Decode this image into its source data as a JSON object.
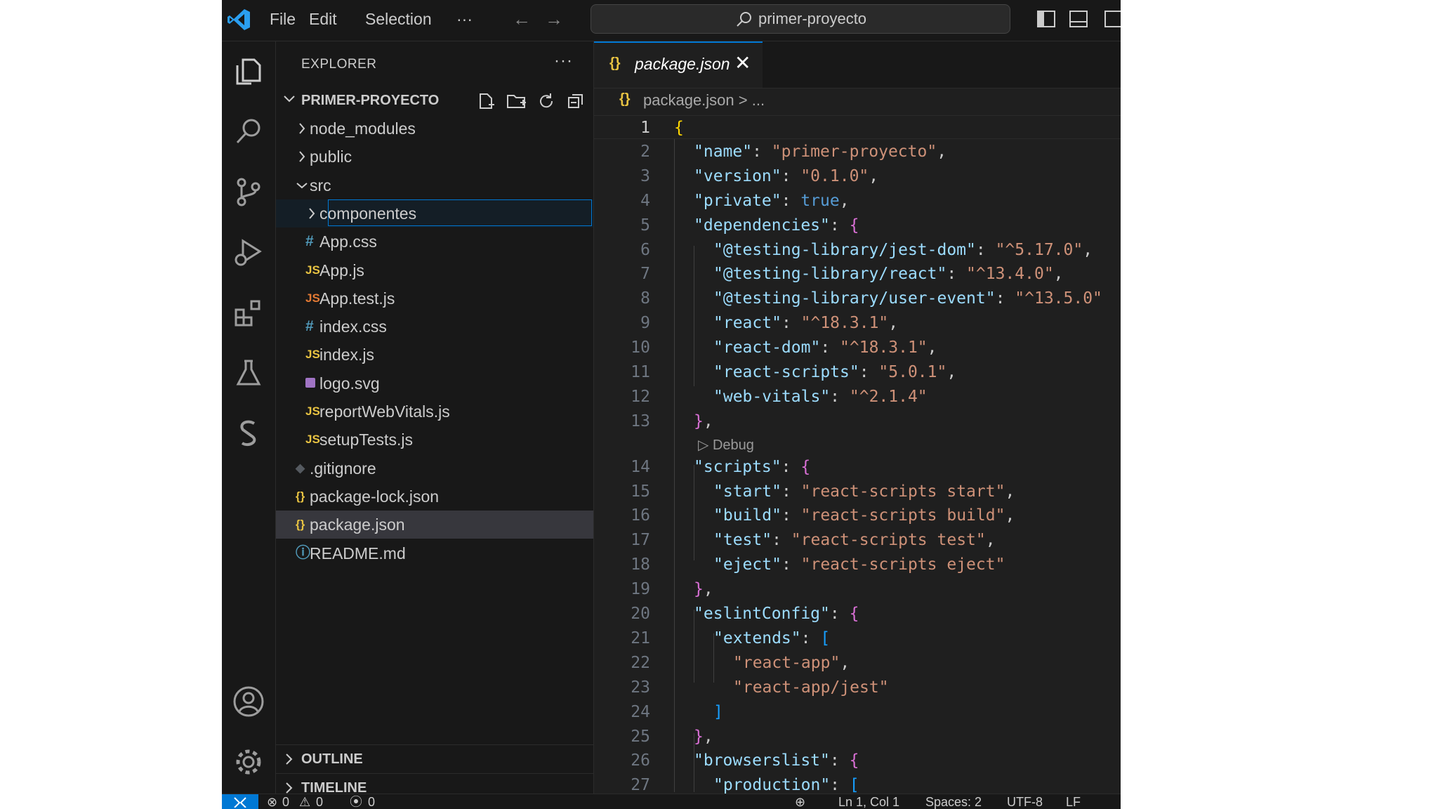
{
  "titlebar": {
    "menu": [
      "File",
      "Edit",
      "Selection",
      "···"
    ],
    "search_text": "primer-proyecto"
  },
  "explorer": {
    "title": "EXPLORER",
    "more": "···",
    "project": "PRIMER-PROYECTO",
    "tree": [
      {
        "name": "node_modules",
        "type": "folder",
        "collapsed": true,
        "depth": 0
      },
      {
        "name": "public",
        "type": "folder",
        "collapsed": true,
        "depth": 0
      },
      {
        "name": "src",
        "type": "folder",
        "collapsed": false,
        "depth": 0
      },
      {
        "name": "componentes",
        "type": "folder",
        "collapsed": true,
        "depth": 1,
        "focused": true
      },
      {
        "name": "App.css",
        "type": "css",
        "icon": "#",
        "depth": 1
      },
      {
        "name": "App.js",
        "type": "js",
        "icon": "JS",
        "depth": 1
      },
      {
        "name": "App.test.js",
        "type": "test",
        "icon": "JS",
        "depth": 1
      },
      {
        "name": "index.css",
        "type": "css",
        "icon": "#",
        "depth": 1
      },
      {
        "name": "index.js",
        "type": "js",
        "icon": "JS",
        "depth": 1
      },
      {
        "name": "logo.svg",
        "type": "svg",
        "icon": "",
        "depth": 1
      },
      {
        "name": "reportWebVitals.js",
        "type": "js",
        "icon": "JS",
        "depth": 1
      },
      {
        "name": "setupTests.js",
        "type": "js",
        "icon": "JS",
        "depth": 1
      },
      {
        "name": ".gitignore",
        "type": "git",
        "icon": "◆",
        "depth": 0
      },
      {
        "name": "package-lock.json",
        "type": "json",
        "icon": "{}",
        "depth": 0
      },
      {
        "name": "package.json",
        "type": "json",
        "icon": "{}",
        "depth": 0,
        "selected": true
      },
      {
        "name": "README.md",
        "type": "info",
        "icon": "ⓘ",
        "depth": 0
      }
    ],
    "sections": [
      "OUTLINE",
      "TIMELINE"
    ]
  },
  "editor": {
    "tab": {
      "icon": "{}",
      "label": "package.json",
      "close": "✕"
    },
    "breadcrumb": {
      "icon": "{}",
      "text": "package.json > ..."
    },
    "codelens": "Debug",
    "lines": [
      {
        "n": "1",
        "indent": 0,
        "tokens": [
          [
            "{",
            "br1"
          ]
        ]
      },
      {
        "n": "2",
        "indent": 1,
        "tokens": [
          [
            "\"name\"",
            "k"
          ],
          [
            ": ",
            "p"
          ],
          [
            "\"primer-proyecto\"",
            "s"
          ],
          [
            ",",
            "p"
          ]
        ]
      },
      {
        "n": "3",
        "indent": 1,
        "tokens": [
          [
            "\"version\"",
            "k"
          ],
          [
            ": ",
            "p"
          ],
          [
            "\"0.1.0\"",
            "s"
          ],
          [
            ",",
            "p"
          ]
        ]
      },
      {
        "n": "4",
        "indent": 1,
        "tokens": [
          [
            "\"private\"",
            "k"
          ],
          [
            ": ",
            "p"
          ],
          [
            "true",
            "b"
          ],
          [
            ",",
            "p"
          ]
        ]
      },
      {
        "n": "5",
        "indent": 1,
        "tokens": [
          [
            "\"dependencies\"",
            "k"
          ],
          [
            ": ",
            "p"
          ],
          [
            "{",
            "br2"
          ]
        ]
      },
      {
        "n": "6",
        "indent": 2,
        "tokens": [
          [
            "\"@testing-library/jest-dom\"",
            "k"
          ],
          [
            ": ",
            "p"
          ],
          [
            "\"^5.17.0\"",
            "s"
          ],
          [
            ",",
            "p"
          ]
        ]
      },
      {
        "n": "7",
        "indent": 2,
        "tokens": [
          [
            "\"@testing-library/react\"",
            "k"
          ],
          [
            ": ",
            "p"
          ],
          [
            "\"^13.4.0\"",
            "s"
          ],
          [
            ",",
            "p"
          ]
        ]
      },
      {
        "n": "8",
        "indent": 2,
        "tokens": [
          [
            "\"@testing-library/user-event\"",
            "k"
          ],
          [
            ": ",
            "p"
          ],
          [
            "\"^13.5.0\"",
            "s"
          ]
        ]
      },
      {
        "n": "9",
        "indent": 2,
        "tokens": [
          [
            "\"react\"",
            "k"
          ],
          [
            ": ",
            "p"
          ],
          [
            "\"^18.3.1\"",
            "s"
          ],
          [
            ",",
            "p"
          ]
        ]
      },
      {
        "n": "10",
        "indent": 2,
        "tokens": [
          [
            "\"react-dom\"",
            "k"
          ],
          [
            ": ",
            "p"
          ],
          [
            "\"^18.3.1\"",
            "s"
          ],
          [
            ",",
            "p"
          ]
        ]
      },
      {
        "n": "11",
        "indent": 2,
        "tokens": [
          [
            "\"react-scripts\"",
            "k"
          ],
          [
            ": ",
            "p"
          ],
          [
            "\"5.0.1\"",
            "s"
          ],
          [
            ",",
            "p"
          ]
        ]
      },
      {
        "n": "12",
        "indent": 2,
        "tokens": [
          [
            "\"web-vitals\"",
            "k"
          ],
          [
            ": ",
            "p"
          ],
          [
            "\"^2.1.4\"",
            "s"
          ]
        ]
      },
      {
        "n": "13",
        "indent": 1,
        "tokens": [
          [
            "}",
            "br2"
          ],
          [
            ",",
            "p"
          ]
        ]
      },
      {
        "n": "14",
        "indent": 1,
        "tokens": [
          [
            "\"scripts\"",
            "k"
          ],
          [
            ": ",
            "p"
          ],
          [
            "{",
            "br2"
          ]
        ]
      },
      {
        "n": "15",
        "indent": 2,
        "tokens": [
          [
            "\"start\"",
            "k"
          ],
          [
            ": ",
            "p"
          ],
          [
            "\"react-scripts start\"",
            "s"
          ],
          [
            ",",
            "p"
          ]
        ]
      },
      {
        "n": "16",
        "indent": 2,
        "tokens": [
          [
            "\"build\"",
            "k"
          ],
          [
            ": ",
            "p"
          ],
          [
            "\"react-scripts build\"",
            "s"
          ],
          [
            ",",
            "p"
          ]
        ]
      },
      {
        "n": "17",
        "indent": 2,
        "tokens": [
          [
            "\"test\"",
            "k"
          ],
          [
            ": ",
            "p"
          ],
          [
            "\"react-scripts test\"",
            "s"
          ],
          [
            ",",
            "p"
          ]
        ]
      },
      {
        "n": "18",
        "indent": 2,
        "tokens": [
          [
            "\"eject\"",
            "k"
          ],
          [
            ": ",
            "p"
          ],
          [
            "\"react-scripts eject\"",
            "s"
          ]
        ]
      },
      {
        "n": "19",
        "indent": 1,
        "tokens": [
          [
            "}",
            "br2"
          ],
          [
            ",",
            "p"
          ]
        ]
      },
      {
        "n": "20",
        "indent": 1,
        "tokens": [
          [
            "\"eslintConfig\"",
            "k"
          ],
          [
            ": ",
            "p"
          ],
          [
            "{",
            "br2"
          ]
        ]
      },
      {
        "n": "21",
        "indent": 2,
        "tokens": [
          [
            "\"extends\"",
            "k"
          ],
          [
            ": ",
            "p"
          ],
          [
            "[",
            "br3"
          ]
        ]
      },
      {
        "n": "22",
        "indent": 3,
        "tokens": [
          [
            "\"react-app\"",
            "s"
          ],
          [
            ",",
            "p"
          ]
        ]
      },
      {
        "n": "23",
        "indent": 3,
        "tokens": [
          [
            "\"react-app/jest\"",
            "s"
          ]
        ]
      },
      {
        "n": "24",
        "indent": 2,
        "tokens": [
          [
            "]",
            "br3"
          ]
        ]
      },
      {
        "n": "25",
        "indent": 1,
        "tokens": [
          [
            "}",
            "br2"
          ],
          [
            ",",
            "p"
          ]
        ]
      },
      {
        "n": "26",
        "indent": 1,
        "tokens": [
          [
            "\"browserslist\"",
            "k"
          ],
          [
            ": ",
            "p"
          ],
          [
            "{",
            "br2"
          ]
        ]
      },
      {
        "n": "27",
        "indent": 2,
        "tokens": [
          [
            "\"production\"",
            "k"
          ],
          [
            ": ",
            "p"
          ],
          [
            "[",
            "br3"
          ]
        ]
      }
    ]
  },
  "statusbar": {
    "errors": "0",
    "warnings": "0",
    "ports": "0",
    "position": "Ln 1, Col 1",
    "spaces": "Spaces: 2",
    "encoding": "UTF-8",
    "eol": "LF"
  },
  "colors": {
    "accent": "#0078d4",
    "editor_bg": "#1f1f1f",
    "sidebar_bg": "#181818"
  }
}
